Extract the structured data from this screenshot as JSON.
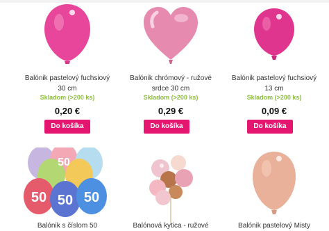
{
  "products": [
    {
      "name_line1": "Balónik pastelový fuchsiový",
      "name_line2": "30 cm",
      "stock": "Skladom (>200 ks)",
      "price": "0,20 €",
      "button": "Do košíka"
    },
    {
      "name_line1": "Balónik chrómový - ružové",
      "name_line2": "srdce 30 cm",
      "stock": "Skladom (>200 ks)",
      "price": "0,29 €",
      "button": "Do košíka"
    },
    {
      "name_line1": "Balónik pastelový fuchsiový",
      "name_line2": "13 cm",
      "stock": "Skladom (>200 ks)",
      "price": "0,09 €",
      "button": "Do košíka"
    },
    {
      "name_line1": "Balónik s číslom 50"
    },
    {
      "name_line1": "Balónová kytica - ružové"
    },
    {
      "name_line1": "Balónik pastelový Misty"
    }
  ],
  "balloon_print": {
    "number": "50"
  },
  "colors": {
    "accent": "#e5166f",
    "stock": "#8cbd3f"
  }
}
